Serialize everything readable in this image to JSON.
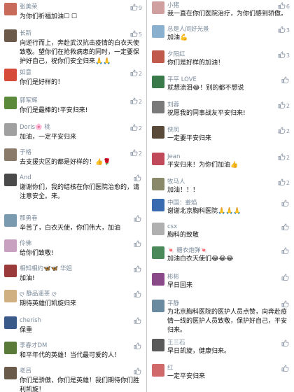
{
  "colors": {
    "name": "#7a8a9a",
    "text": "#111111",
    "like": "#8a95a5"
  },
  "like_icon": "thumbs-up-icon",
  "left": [
    {
      "name": "张美荣",
      "text": "为你们祈福加油☐ ☐",
      "likes": "9",
      "avatar": "#c86b5a"
    },
    {
      "name": "长新",
      "text": "向逆行而上，奔赴武汉抗击疫情的白衣天使致敬。望你们在抢救病患的同时，一定要保护好自己，祝你们安全归来🙏🙏",
      "likes": "5",
      "avatar": "#6b5a4a"
    },
    {
      "name": "如意",
      "text": "你们是好样的！",
      "likes": "2",
      "avatar": "#d64a3a"
    },
    {
      "name": "郭军辉",
      "text": "你们是最棒的!平安归来!",
      "likes": "2",
      "avatar": "#5a8a3a"
    },
    {
      "name": "Doris🌸 桃",
      "text": "加油，一定平安归来",
      "likes": "2",
      "avatar": "#a0a0a0"
    },
    {
      "name": "子格",
      "text": "去支援灾区的都是好样的！👍🌹",
      "likes": "2",
      "avatar": "#8a7a6a"
    },
    {
      "name": "And",
      "text": "谢谢你们，我的结核在你们医院治愈的，请注意安全。来。",
      "likes": "",
      "avatar": "#4a4a4a"
    },
    {
      "name": "那勇春",
      "text": "辛苦了，白衣天使，你们伟大，加油",
      "likes": "",
      "avatar": "#7a9ab0"
    },
    {
      "name": "伶佛",
      "text": "给你们致敬!",
      "likes": "",
      "avatar": "#c8a0c0"
    },
    {
      "name": "相知相约🦋🦋 华姐",
      "text": "加油!",
      "likes": "",
      "avatar": "#9a3a3a"
    },
    {
      "name": "ღ 静品遥茶 ღ",
      "text": "期待英雄们凯旋归来",
      "likes": "",
      "avatar": "#d0b080"
    },
    {
      "name": "cherish",
      "text": "保重",
      "likes": "",
      "avatar": "#3a5a8a"
    },
    {
      "name": "李春才DM",
      "text": "和平年代的英雄！当代最可爱的人！",
      "likes": "",
      "avatar": "#5a7a3a"
    },
    {
      "name": "老吕",
      "text": "你们是骄傲，你们是英雄！我们期待你们胜利凯旋！",
      "likes": "",
      "avatar": "#6a5a4a"
    }
  ],
  "right": [
    {
      "name": "小猪",
      "text": "我一直在你们医院治疗，为你们感到骄傲。",
      "likes": "6",
      "avatar": "#d0a0a0"
    },
    {
      "name": "总是人间好光景",
      "text": "加油💪",
      "likes": "3",
      "avatar": "#8ab0d0"
    },
    {
      "name": "夕阳红",
      "text": "你们是好样的加油！",
      "likes": "3",
      "avatar": "#c05a4a"
    },
    {
      "name": "平平 LOVE",
      "text": "就想流泪😂！别的都不想说",
      "likes": "",
      "avatar": "#3a7a4a"
    },
    {
      "name": "刘蓉",
      "text": "祝愿我的同事战友平安归来!",
      "likes": "2",
      "avatar": "#7a7a7a"
    },
    {
      "name": "侠凤",
      "text": "一定要平安归来",
      "likes": "2",
      "avatar": "#5a4a3a"
    },
    {
      "name": "Jean",
      "text": "平安归来！为你们加油👍",
      "likes": "2",
      "avatar": "#c04a5a"
    },
    {
      "name": "牧马人",
      "text": "加油！！！",
      "likes": "2",
      "avatar": "#8a8a6a"
    },
    {
      "name": "中国：姜焰",
      "text": "谢谢北京胸科医院🙏🙏🙏",
      "likes": "",
      "avatar": "#3a6ab0"
    },
    {
      "name": "csx",
      "text": "胸科的致敬",
      "likes": "",
      "avatar": "#b0b0b0"
    },
    {
      "name": "🍬 糖衣炮弹🍬",
      "text": "加油白衣天使们😂😂😂",
      "likes": "",
      "avatar": "#4a8a5a"
    },
    {
      "name": "彬彬",
      "text": "早日回来",
      "likes": "",
      "avatar": "#8a4a8a"
    },
    {
      "name": "平静",
      "text": "为北京胸科医院的医护人员点赞，向奔赴疫情一线的医护人员致敬，保护好自己，平安归来。",
      "likes": "",
      "avatar": "#6a8aa0"
    },
    {
      "name": "王三石",
      "text": "早日凯旋，健康归来。",
      "likes": "",
      "avatar": "#5a5a5a"
    },
    {
      "name": "红",
      "text": "一定平安归来",
      "likes": "",
      "avatar": "#d06a6a"
    }
  ]
}
